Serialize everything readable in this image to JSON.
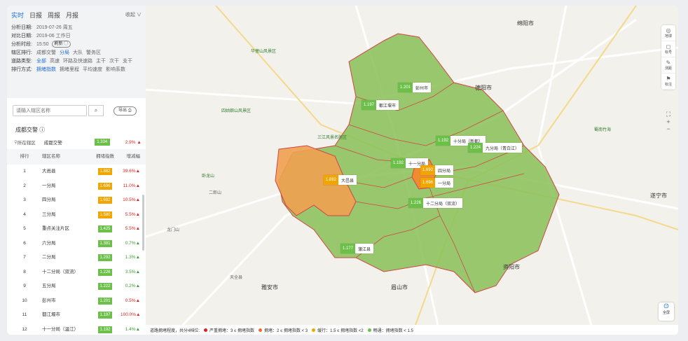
{
  "tabs": [
    "实时",
    "日报",
    "周报",
    "月报"
  ],
  "collapse_label": "收起 ∨",
  "info": {
    "analysis_date_label": "分析日期:",
    "analysis_date": "2019-07-26 周五",
    "compare_date_label": "对比日期:",
    "compare_date": "2019-06 工作日",
    "analysis_time_label": "分析时段:",
    "analysis_time": "15:50",
    "refresh_label": "刷新 ◯",
    "district_rank_label": "辖区排行:",
    "district_rank_opts": [
      "成都交警",
      "分局",
      "大队",
      "警务区"
    ],
    "road_type_label": "道路类型:",
    "road_type_opts": [
      "全部",
      "高速",
      "环路及快速路",
      "主干",
      "次干",
      "支干"
    ],
    "sort_label": "排行方式:",
    "sort_opts": [
      "拥堵指数",
      "拥堵里程",
      "平均速度",
      "影响系数"
    ]
  },
  "search": {
    "placeholder": "请输入辖区名称",
    "export_label": "导出"
  },
  "region_title": "成都交警 ⓘ",
  "current": {
    "label": "所在辖区",
    "name": "成都交警",
    "index": "1.334",
    "delta": "2.9%"
  },
  "table": {
    "headers": [
      "排行",
      "辖区名称",
      "拥堵指数",
      "增减幅"
    ],
    "rows": [
      {
        "rank": "1",
        "name": "大邑县",
        "index": "1.882",
        "delta": "39.6%",
        "color": "#f0a500",
        "dir": "up"
      },
      {
        "rank": "2",
        "name": "一分局",
        "index": "1.696",
        "delta": "11.0%",
        "color": "#f0a500",
        "dir": "up"
      },
      {
        "rank": "3",
        "name": "四分局",
        "index": "1.692",
        "delta": "10.5%",
        "color": "#f0a500",
        "dir": "up"
      },
      {
        "rank": "4",
        "name": "三分局",
        "index": "1.580",
        "delta": "5.5%",
        "color": "#f0a500",
        "dir": "up"
      },
      {
        "rank": "5",
        "name": "重点关注片区",
        "index": "1.425",
        "delta": "5.5%",
        "color": "#6cc04a",
        "dir": "up"
      },
      {
        "rank": "6",
        "name": "六分局",
        "index": "1.381",
        "delta": "0.7%",
        "color": "#6cc04a",
        "dir": "upg"
      },
      {
        "rank": "7",
        "name": "二分局",
        "index": "1.292",
        "delta": "1.3%",
        "color": "#6cc04a",
        "dir": "upg"
      },
      {
        "rank": "8",
        "name": "十二分局（双流）",
        "index": "1.226",
        "delta": "3.5%",
        "color": "#6cc04a",
        "dir": "upg"
      },
      {
        "rank": "9",
        "name": "五分局",
        "index": "1.222",
        "delta": "0.2%",
        "color": "#6cc04a",
        "dir": "upg"
      },
      {
        "rank": "10",
        "name": "彭州市",
        "index": "1.201",
        "delta": "0.5%",
        "color": "#6cc04a",
        "dir": "up"
      },
      {
        "rank": "11",
        "name": "都江堰市",
        "index": "1.197",
        "delta": "100.0%",
        "color": "#6cc04a",
        "dir": "up"
      },
      {
        "rank": "12",
        "name": "十一分局（温江）",
        "index": "1.192",
        "delta": "1.4%",
        "color": "#6cc04a",
        "dir": "upg"
      }
    ]
  },
  "map": {
    "places": [
      {
        "t": "绵阳市",
        "c": "city"
      },
      {
        "t": "德阳市",
        "c": "city"
      },
      {
        "t": "遂宁市",
        "c": "city"
      },
      {
        "t": "资阳市",
        "c": "city"
      },
      {
        "t": "眉山市",
        "c": "city"
      },
      {
        "t": "雅安市",
        "c": "city"
      },
      {
        "t": "华蓥山风景区",
        "c": "park"
      },
      {
        "t": "四姑娘山风景区",
        "c": "park"
      },
      {
        "t": "三江风景名胜区",
        "c": "park"
      },
      {
        "t": "卧龙山",
        "c": "park"
      },
      {
        "t": "蜀南竹海",
        "c": "park"
      },
      {
        "t": "二郎山",
        "c": ""
      },
      {
        "t": "龙门山",
        "c": ""
      },
      {
        "t": "天全县",
        "c": ""
      }
    ],
    "markers": [
      {
        "v": "1.201",
        "n": "彭州市",
        "c": "#6cc04a"
      },
      {
        "v": "1.197",
        "n": "都江堰市",
        "c": "#6cc04a"
      },
      {
        "v": "1.192",
        "n": "十分局（新都）",
        "c": "#6cc04a"
      },
      {
        "v": "1.192",
        "n": "十一分局",
        "c": "#6cc04a"
      },
      {
        "v": "1.692",
        "n": "四分局",
        "c": "#f0a500"
      },
      {
        "v": "1.696",
        "n": "一分局",
        "c": "#f0a500"
      },
      {
        "v": "1.882",
        "n": "大邑县",
        "c": "#f0a500"
      },
      {
        "v": "1.177",
        "n": "蒲江县",
        "c": "#6cc04a"
      },
      {
        "v": "1.226",
        "n": "十二分局（双流）",
        "c": "#6cc04a"
      },
      {
        "v": "1.224",
        "n": "九分局（青白江）",
        "c": "#6cc04a"
      }
    ],
    "legend": {
      "title": "道路拥堵程度，共分4档位:",
      "items": [
        {
          "label": "严重拥堵：3 ≤ 拥堵指数",
          "color": "#e02020"
        },
        {
          "label": "拥堵：2 ≤ 拥堵指数 < 3",
          "color": "#f06a30"
        },
        {
          "label": "缓行：1.5 ≤ 拥堵指数 <2",
          "color": "#f0a500"
        },
        {
          "label": "畅通：拥堵指数 < 1.5",
          "color": "#6cc04a"
        }
      ]
    },
    "tools": [
      "地球",
      "标号",
      "测距",
      "标注"
    ],
    "full_label": "全屏"
  }
}
